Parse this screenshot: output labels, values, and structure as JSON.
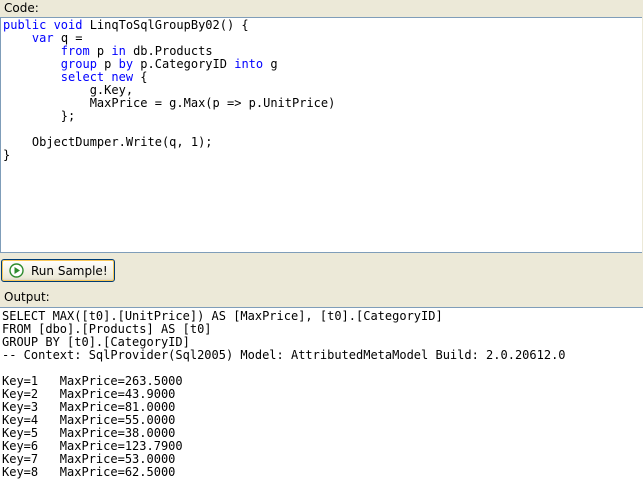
{
  "code_label": "Code:",
  "code": {
    "l1_kw": "public void",
    "l1_rest": " LinqToSqlGroupBy02() {",
    "l2_kw": "var",
    "l2_rest": " q =",
    "l3_kw1": "from",
    "l3_mid": " p ",
    "l3_kw2": "in",
    "l3_rest": " db.Products",
    "l4_kw1": "group",
    "l4_mid1": " p ",
    "l4_kw2": "by",
    "l4_mid2": " p.CategoryID ",
    "l4_kw3": "into",
    "l4_rest": " g",
    "l5_kw": "select new",
    "l5_rest": " {",
    "l6": "g.Key,",
    "l7": "MaxPrice = g.Max(p => p.UnitPrice)",
    "l8": "};",
    "l10": "ObjectDumper.Write(q, 1);",
    "l11": "}"
  },
  "run_button": {
    "label": "Run Sample!",
    "icon": "play-icon",
    "icon_color": "#2e8b2e"
  },
  "output_label": "Output:",
  "output": {
    "sql": [
      "SELECT MAX([t0].[UnitPrice]) AS [MaxPrice], [t0].[CategoryID]",
      "FROM [dbo].[Products] AS [t0]",
      "GROUP BY [t0].[CategoryID]",
      "-- Context: SqlProvider(Sql2005) Model: AttributedMetaModel Build: 2.0.20612.0"
    ],
    "results": [
      "Key=1   MaxPrice=263.5000",
      "Key=2   MaxPrice=43.9000",
      "Key=3   MaxPrice=81.0000",
      "Key=4   MaxPrice=55.0000",
      "Key=5   MaxPrice=38.0000",
      "Key=6   MaxPrice=123.7900",
      "Key=7   MaxPrice=53.0000",
      "Key=8   MaxPrice=62.5000"
    ]
  },
  "colors": {
    "keyword": "#0000ff",
    "panel_bg": "#ece9d8",
    "border": "#7f9db9"
  }
}
